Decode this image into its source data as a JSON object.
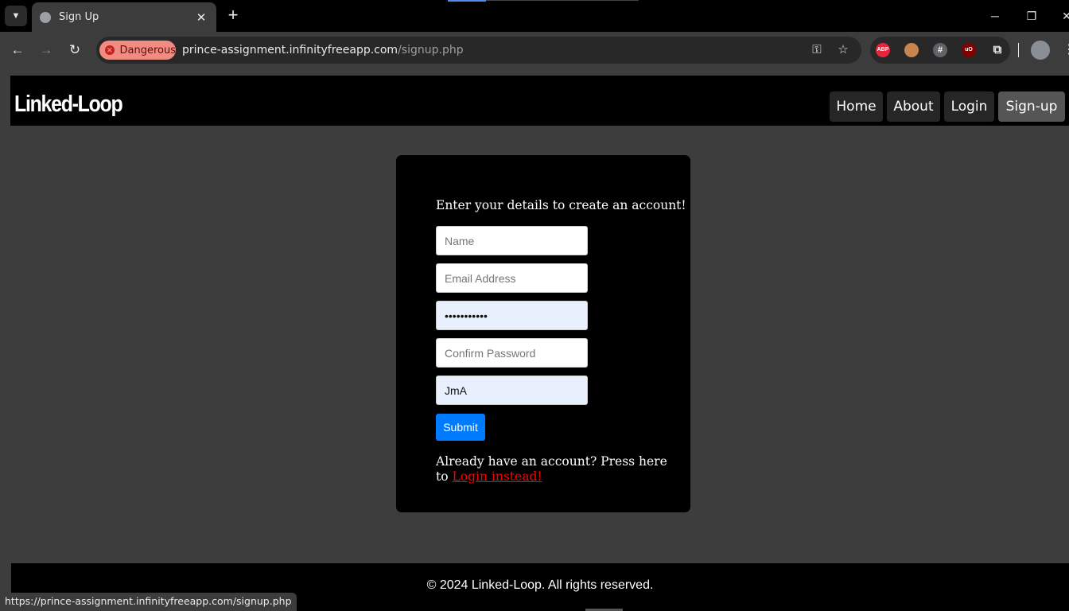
{
  "browser": {
    "tab_title": "Sign Up",
    "tab_close": "✕",
    "new_tab": "+",
    "danger_label": "Dangerous",
    "url_host": "prince-assignment.infinityfreeapp.com",
    "url_path": "/signup.php",
    "status_url": "https://prince-assignment.infinityfreeapp.com/signup.php",
    "extensions": [
      {
        "name": "adblock-plus-icon",
        "text": "ABP",
        "color": "#e8253d"
      },
      {
        "name": "cookie-icon",
        "text": "",
        "color": "#c9854d"
      },
      {
        "name": "hashtag-extension-icon",
        "text": "#",
        "color": "#5f6368"
      },
      {
        "name": "ublock-origin-icon",
        "text": "uO",
        "color": "#800000"
      }
    ]
  },
  "site": {
    "brand": "Linked-Loop",
    "nav": [
      "Home",
      "About",
      "Login",
      "Sign-up"
    ],
    "active_nav": "Sign-up"
  },
  "form": {
    "heading": "Enter your details to create an account!",
    "name_placeholder": "Name",
    "email_placeholder": "Email Address",
    "password_value": "•••••••••••",
    "confirm_placeholder": "Confirm Password",
    "extra_value": "JmA",
    "submit_label": "Submit",
    "login_prompt": "Already have an account? Press here to",
    "login_link": "Login instead!"
  },
  "footer": {
    "text": "© 2024 Linked-Loop. All rights reserved."
  },
  "colors": {
    "accent": "#007bff",
    "danger": "#f28b82",
    "link": "#ff0000",
    "page_bg": "#3d3d3d"
  }
}
